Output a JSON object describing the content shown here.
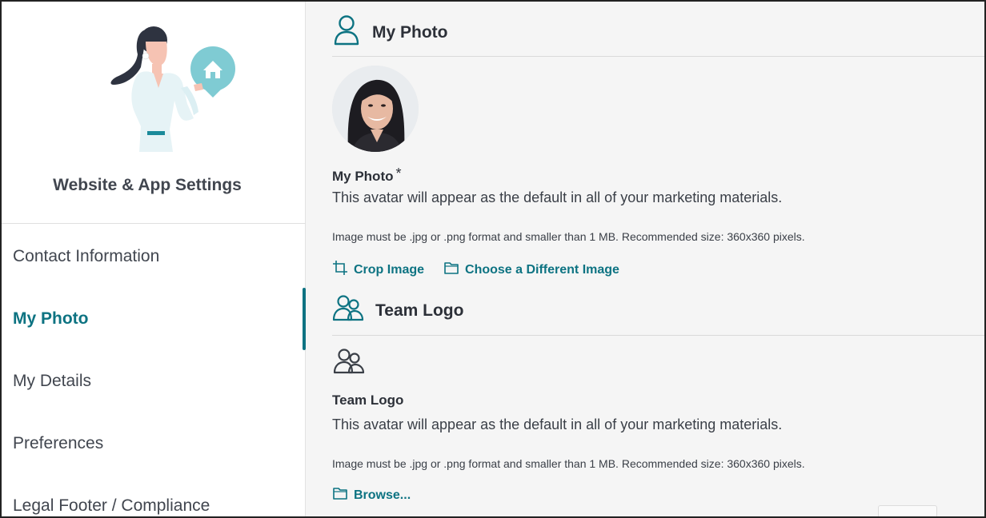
{
  "sidebar": {
    "title": "Website & App Settings",
    "illustration": "woman-holding-home-pin-illustration",
    "items": [
      {
        "label": "Contact Information",
        "active": false
      },
      {
        "label": "My Photo",
        "active": true
      },
      {
        "label": "My Details",
        "active": false
      },
      {
        "label": "Preferences",
        "active": false
      },
      {
        "label": "Legal Footer / Compliance",
        "active": false
      }
    ]
  },
  "my_photo": {
    "heading": "My Photo",
    "heading_icon": "person-icon",
    "field_label": "My Photo",
    "required_mark": "*",
    "description": "This avatar will appear as the default in all of your marketing materials.",
    "hint": "Image must be .jpg or .png format and smaller than 1 MB. Recommended size: 360x360 pixels.",
    "crop_label": "Crop Image",
    "choose_label": "Choose a Different Image"
  },
  "team_logo": {
    "heading": "Team Logo",
    "heading_icon": "group-icon",
    "field_label": "Team Logo",
    "description": "This avatar will appear as the default in all of your marketing materials.",
    "hint": "Image must be .jpg or .png format and smaller than 1 MB. Recommended size: 360x360 pixels.",
    "browse_label": "Browse..."
  },
  "colors": {
    "accent": "#0d7382",
    "text": "#3a3f47",
    "panel_bg": "#f5f5f5"
  }
}
